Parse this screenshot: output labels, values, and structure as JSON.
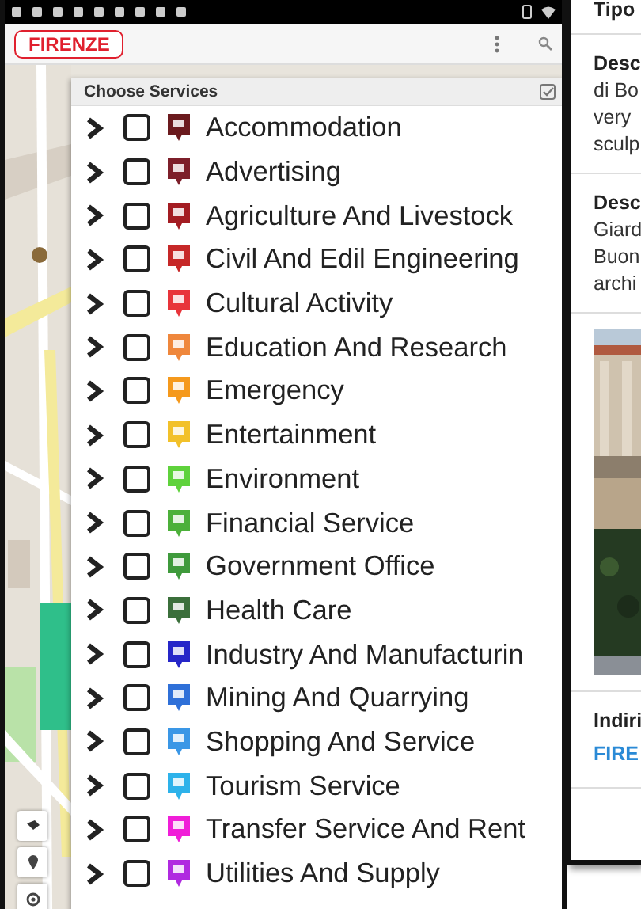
{
  "app_bar": {
    "city": "FIRENZE"
  },
  "services_panel": {
    "title": "Choose Services",
    "items": [
      {
        "label": "Accommodation",
        "color": "#6b1a1e",
        "checked": false,
        "expanded": false
      },
      {
        "label": "Advertising",
        "color": "#7d1f2a",
        "checked": false,
        "expanded": false
      },
      {
        "label": "Agriculture And Livestock",
        "color": "#a31c22",
        "checked": false,
        "expanded": false
      },
      {
        "label": "Civil And Edil Engineering",
        "color": "#c62828",
        "checked": false,
        "expanded": false
      },
      {
        "label": "Cultural Activity",
        "color": "#e8343a",
        "checked": false,
        "expanded": false
      },
      {
        "label": "Education And Research",
        "color": "#ef873c",
        "checked": false,
        "expanded": false
      },
      {
        "label": "Emergency",
        "color": "#f5991c",
        "checked": false,
        "expanded": false
      },
      {
        "label": "Entertainment",
        "color": "#f2c12a",
        "checked": false,
        "expanded": false
      },
      {
        "label": "Environment",
        "color": "#5fd23c",
        "checked": false,
        "expanded": false
      },
      {
        "label": "Financial Service",
        "color": "#4cb03a",
        "checked": false,
        "expanded": false
      },
      {
        "label": "Government Office",
        "color": "#3f9a3c",
        "checked": false,
        "expanded": false
      },
      {
        "label": "Health Care",
        "color": "#3b6f3b",
        "checked": false,
        "expanded": false
      },
      {
        "label": "Industry And Manufacturin",
        "color": "#2626c8",
        "checked": false,
        "expanded": false
      },
      {
        "label": "Mining And Quarrying",
        "color": "#2f70d8",
        "checked": false,
        "expanded": false
      },
      {
        "label": "Shopping And Service",
        "color": "#3a97e6",
        "checked": false,
        "expanded": false
      },
      {
        "label": "Tourism Service",
        "color": "#2db2ea",
        "checked": false,
        "expanded": false
      },
      {
        "label": "Transfer Service And Rent",
        "color": "#f01ed8",
        "checked": false,
        "expanded": false
      },
      {
        "label": "Utilities And Supply",
        "color": "#b02ae0",
        "checked": false,
        "expanded": false
      }
    ]
  },
  "detail_card": {
    "heading": "Tipo",
    "sections": [
      {
        "title": "Desc",
        "lines": [
          "di Bo",
          "very",
          "sculp"
        ]
      },
      {
        "title": "Desc",
        "lines": [
          "Giard",
          "Buon",
          "archi"
        ]
      }
    ],
    "address": {
      "label": "Indiri",
      "value": "FIRE"
    }
  }
}
